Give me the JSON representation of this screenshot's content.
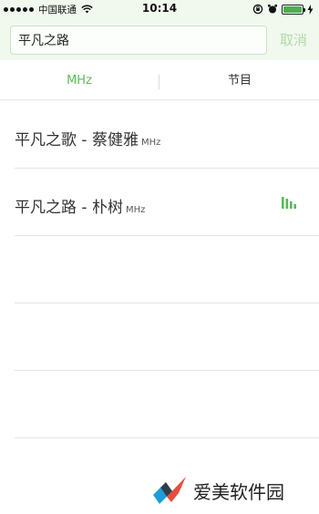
{
  "status_bar": {
    "carrier": "中国联通",
    "time": "10:14",
    "battery_level": 1.0
  },
  "search": {
    "value": "平凡之路",
    "placeholder": "",
    "cancel_label": "取消"
  },
  "tabs": [
    {
      "label": "MHz",
      "active": true
    },
    {
      "label": "节目",
      "active": false
    }
  ],
  "results": [
    {
      "title": "平凡之歌 - 蔡健雅",
      "unit": "MHz",
      "playing": false
    },
    {
      "title": "平凡之路 - 朴树",
      "unit": "MHz",
      "playing": true
    }
  ],
  "watermark": {
    "text": "爱美软件园"
  },
  "colors": {
    "accent": "#5cb85c",
    "header_bg": "#f1f8ee",
    "cancel_text": "#b3d9a6"
  }
}
